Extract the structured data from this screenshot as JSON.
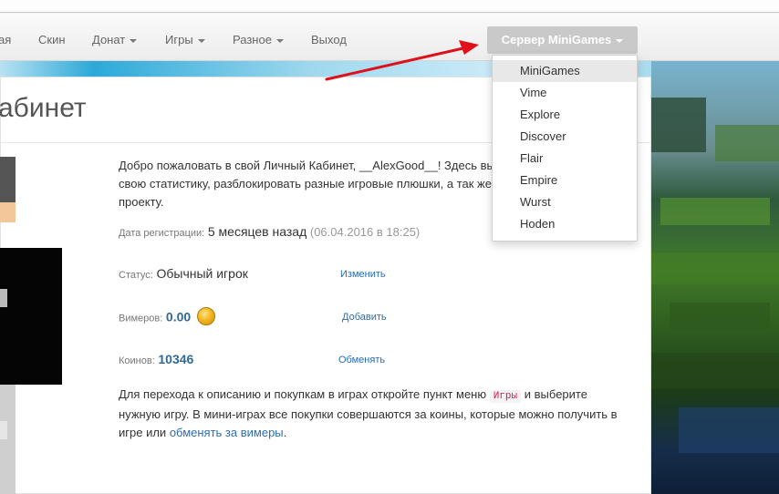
{
  "nav": {
    "items": [
      {
        "label": "ая",
        "dropdown": false
      },
      {
        "label": "Скин",
        "dropdown": false
      },
      {
        "label": "Донат",
        "dropdown": true
      },
      {
        "label": "Игры",
        "dropdown": true
      },
      {
        "label": "Разное",
        "dropdown": true
      },
      {
        "label": "Выход",
        "dropdown": false
      }
    ],
    "server_button": "Сервер MiniGames"
  },
  "dropdown": {
    "items": [
      "MiniGames",
      "Vime",
      "Explore",
      "Discover",
      "Flair",
      "Empire",
      "Wurst",
      "Hoden"
    ],
    "active_index": 0
  },
  "page": {
    "title": "абинет",
    "welcome": "Добро пожаловать в свой Личный Кабинет, __AlexGood__! Здесь вы свою статистику, разблокировать разные игровые плюшки, а так же проекту.",
    "registration": {
      "label": "Дата регистрации:",
      "value": "5 месяцев назад",
      "date": "(06.04.2016 в 18:25)"
    },
    "status": {
      "label": "Статус:",
      "value": "Обычный игрок",
      "action": "Изменить"
    },
    "vimers": {
      "label": "Вимеров:",
      "value": "0.00",
      "action": "Добавить"
    },
    "coins": {
      "label": "Коинов:",
      "value": "10346",
      "action": "Обменять"
    },
    "footer": {
      "part1": "Для перехода к описанию и покупкам в играх откройте пункт меню",
      "tag": "Игры",
      "part2": "и выберите нужную игру. В мини-играх все покупки совершаются за коины, которые можно получить в игре или",
      "link": "обменять за вимеры",
      "end": "."
    }
  },
  "colors": {
    "accent_link": "#2a6db5",
    "value_blue": "#2f6a99",
    "server_button_bg": "#c9c9c9",
    "arrow": "#e0101a"
  },
  "icons": [
    "caret-down-icon",
    "gold-coin-icon",
    "red-arrow-annotation"
  ]
}
